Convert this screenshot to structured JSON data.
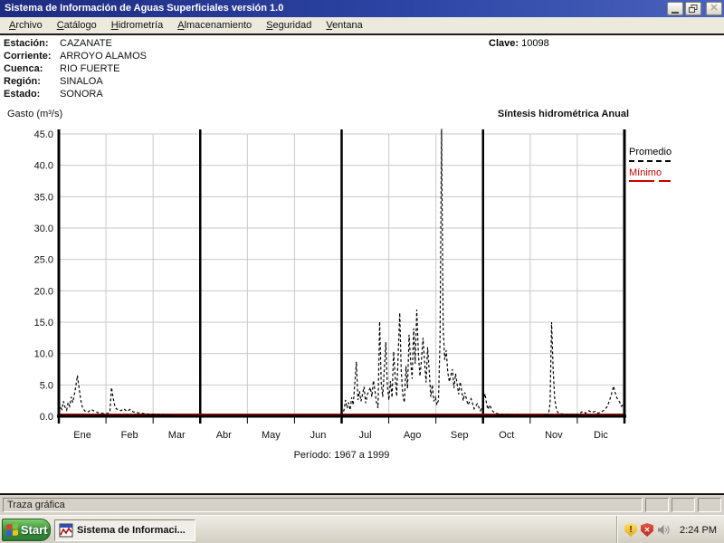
{
  "window": {
    "title": "Sistema de Información de Aguas Superficiales  versión 1.0"
  },
  "menu": {
    "items": [
      {
        "label": "Archivo"
      },
      {
        "label": "Catálogo"
      },
      {
        "label": "Hidrometría"
      },
      {
        "label": "Almacenamiento"
      },
      {
        "label": "Seguridad"
      },
      {
        "label": "Ventana"
      }
    ]
  },
  "station": {
    "rows": [
      {
        "label": "Estación:",
        "value": "CAZANATE"
      },
      {
        "label": "Corriente:",
        "value": "ARROYO ALAMOS"
      },
      {
        "label": "Cuenca:",
        "value": "RIO FUERTE"
      },
      {
        "label": "Región:",
        "value": "SINALOA"
      },
      {
        "label": "Estado:",
        "value": "SONORA"
      }
    ],
    "clave_label": "Clave:",
    "clave_value": "10098"
  },
  "chart_header": {
    "y_unit_label": "Gasto (m³/s)",
    "right_title": "Síntesis hidrométrica  Anual"
  },
  "chart_data": {
    "type": "line",
    "title": "Síntesis hidrométrica Anual",
    "ylabel": "Gasto (m3/s)",
    "x_unit": "day_of_year",
    "caption": "Período: 1967 a 1999",
    "months": [
      "Ene",
      "Feb",
      "Mar",
      "Abr",
      "May",
      "Jun",
      "Jul",
      "Ago",
      "Sep",
      "Oct",
      "Nov",
      "Dic"
    ],
    "ylim": [
      0,
      45
    ],
    "yticks": [
      0,
      5,
      10,
      15,
      20,
      25,
      30,
      35,
      40,
      45
    ],
    "grid": true,
    "legend_position": "right",
    "series": [
      {
        "name": "Promedio",
        "style": "dashed",
        "color": "#000000",
        "points": [
          [
            1,
            1.4
          ],
          [
            2,
            1.1
          ],
          [
            3,
            2.4
          ],
          [
            4,
            1.5
          ],
          [
            5,
            1.0
          ],
          [
            6,
            2.2
          ],
          [
            7,
            1.6
          ],
          [
            8,
            3.1
          ],
          [
            9,
            2.2
          ],
          [
            10,
            3.4
          ],
          [
            11,
            4.8
          ],
          [
            12,
            6.5
          ],
          [
            13,
            4.6
          ],
          [
            14,
            2.8
          ],
          [
            15,
            1.6
          ],
          [
            16,
            1.1
          ],
          [
            17,
            0.8
          ],
          [
            19,
            0.7
          ],
          [
            21,
            1.1
          ],
          [
            23,
            0.8
          ],
          [
            25,
            0.6
          ],
          [
            27,
            0.5
          ],
          [
            29,
            0.45
          ],
          [
            31,
            0.4
          ],
          [
            33,
            0.8
          ],
          [
            34,
            4.6
          ],
          [
            35,
            3.0
          ],
          [
            36,
            1.8
          ],
          [
            37,
            1.2
          ],
          [
            40,
            0.9
          ],
          [
            42,
            1.2
          ],
          [
            44,
            0.8
          ],
          [
            46,
            1.1
          ],
          [
            48,
            0.7
          ],
          [
            50,
            0.6
          ],
          [
            53,
            0.5
          ],
          [
            56,
            0.4
          ],
          [
            58,
            0.35
          ],
          [
            62,
            0.3
          ],
          [
            66,
            0.25
          ],
          [
            70,
            0.2
          ],
          [
            75,
            0.15
          ],
          [
            80,
            0.12
          ],
          [
            85,
            0.1
          ],
          [
            90,
            0.1
          ],
          [
            100,
            0.08
          ],
          [
            120,
            0.06
          ],
          [
            140,
            0.05
          ],
          [
            160,
            0.05
          ],
          [
            175,
            0.06
          ],
          [
            181,
            0.1
          ],
          [
            183,
            0.3
          ],
          [
            184,
            1.0
          ],
          [
            185,
            2.6
          ],
          [
            186,
            1.3
          ],
          [
            187,
            2.2
          ],
          [
            188,
            1.0
          ],
          [
            189,
            3.0
          ],
          [
            190,
            1.8
          ],
          [
            192,
            8.7
          ],
          [
            193,
            2.6
          ],
          [
            194,
            4.0
          ],
          [
            195,
            2.4
          ],
          [
            197,
            4.7
          ],
          [
            198,
            2.1
          ],
          [
            199,
            3.4
          ],
          [
            201,
            4.6
          ],
          [
            202,
            3.1
          ],
          [
            203,
            5.7
          ],
          [
            204,
            4.1
          ],
          [
            205,
            2.2
          ],
          [
            206,
            1.3
          ],
          [
            207,
            15.1
          ],
          [
            208,
            5.4
          ],
          [
            209,
            3.1
          ],
          [
            211,
            11.8
          ],
          [
            212,
            4.9
          ],
          [
            213,
            2.6
          ],
          [
            214,
            5.6
          ],
          [
            215,
            3.0
          ],
          [
            216,
            10.3
          ],
          [
            217,
            6.4
          ],
          [
            218,
            3.2
          ],
          [
            220,
            16.5
          ],
          [
            221,
            7.0
          ],
          [
            222,
            3.4
          ],
          [
            223,
            2.2
          ],
          [
            224,
            8.0
          ],
          [
            225,
            4.4
          ],
          [
            226,
            13.0
          ],
          [
            227,
            8.8
          ],
          [
            228,
            6.0
          ],
          [
            229,
            14.0
          ],
          [
            230,
            8.4
          ],
          [
            231,
            17.0
          ],
          [
            232,
            10.0
          ],
          [
            233,
            6.4
          ],
          [
            234,
            9.0
          ],
          [
            235,
            12.5
          ],
          [
            236,
            8.8
          ],
          [
            237,
            5.4
          ],
          [
            238,
            11.0
          ],
          [
            239,
            7.4
          ],
          [
            240,
            3.1
          ],
          [
            241,
            5.0
          ],
          [
            242,
            2.4
          ],
          [
            243,
            3.0
          ],
          [
            244,
            1.8
          ],
          [
            245,
            2.6
          ],
          [
            246,
            12.0
          ],
          [
            247,
            45.8
          ],
          [
            248,
            14.0
          ],
          [
            249,
            9.0
          ],
          [
            250,
            10.5
          ],
          [
            251,
            7.0
          ],
          [
            252,
            5.5
          ],
          [
            254,
            7.5
          ],
          [
            255,
            4.5
          ],
          [
            256,
            6.8
          ],
          [
            258,
            3.5
          ],
          [
            259,
            5.5
          ],
          [
            261,
            2.5
          ],
          [
            262,
            3.8
          ],
          [
            264,
            1.8
          ],
          [
            266,
            2.8
          ],
          [
            268,
            1.2
          ],
          [
            270,
            2.0
          ],
          [
            272,
            0.9
          ],
          [
            273,
            1.4
          ],
          [
            275,
            3.6
          ],
          [
            276,
            2.0
          ],
          [
            277,
            1.1
          ],
          [
            278,
            1.8
          ],
          [
            280,
            0.8
          ],
          [
            282,
            0.5
          ],
          [
            284,
            0.35
          ],
          [
            288,
            0.25
          ],
          [
            292,
            0.2
          ],
          [
            296,
            0.15
          ],
          [
            300,
            0.13
          ],
          [
            304,
            0.12
          ],
          [
            308,
            0.12
          ],
          [
            312,
            0.15
          ],
          [
            316,
            0.3
          ],
          [
            317,
            2.0
          ],
          [
            318,
            15.0
          ],
          [
            319,
            7.5
          ],
          [
            320,
            2.8
          ],
          [
            321,
            1.2
          ],
          [
            322,
            0.6
          ],
          [
            324,
            0.4
          ],
          [
            327,
            0.3
          ],
          [
            330,
            0.25
          ],
          [
            334,
            0.3
          ],
          [
            336,
            0.4
          ],
          [
            338,
            0.8
          ],
          [
            340,
            0.5
          ],
          [
            342,
            0.9
          ],
          [
            344,
            0.6
          ],
          [
            346,
            0.8
          ],
          [
            348,
            0.5
          ],
          [
            350,
            0.7
          ],
          [
            352,
            1.0
          ],
          [
            354,
            1.6
          ],
          [
            356,
            3.0
          ],
          [
            358,
            4.8
          ],
          [
            359,
            3.8
          ],
          [
            360,
            3.0
          ],
          [
            361,
            2.6
          ],
          [
            362,
            2.2
          ],
          [
            363,
            1.6
          ],
          [
            364,
            1.8
          ],
          [
            365,
            2.2
          ]
        ]
      },
      {
        "name": "Mínimo",
        "style": "solid",
        "color": "#990000",
        "points": [
          [
            1,
            0
          ],
          [
            365,
            0
          ]
        ]
      }
    ]
  },
  "status_bar": {
    "text": "Traza gráfica"
  },
  "taskbar": {
    "start_label": "Start",
    "app_button_label": "Sistema de Informaci...",
    "clock": "2:24 PM"
  }
}
